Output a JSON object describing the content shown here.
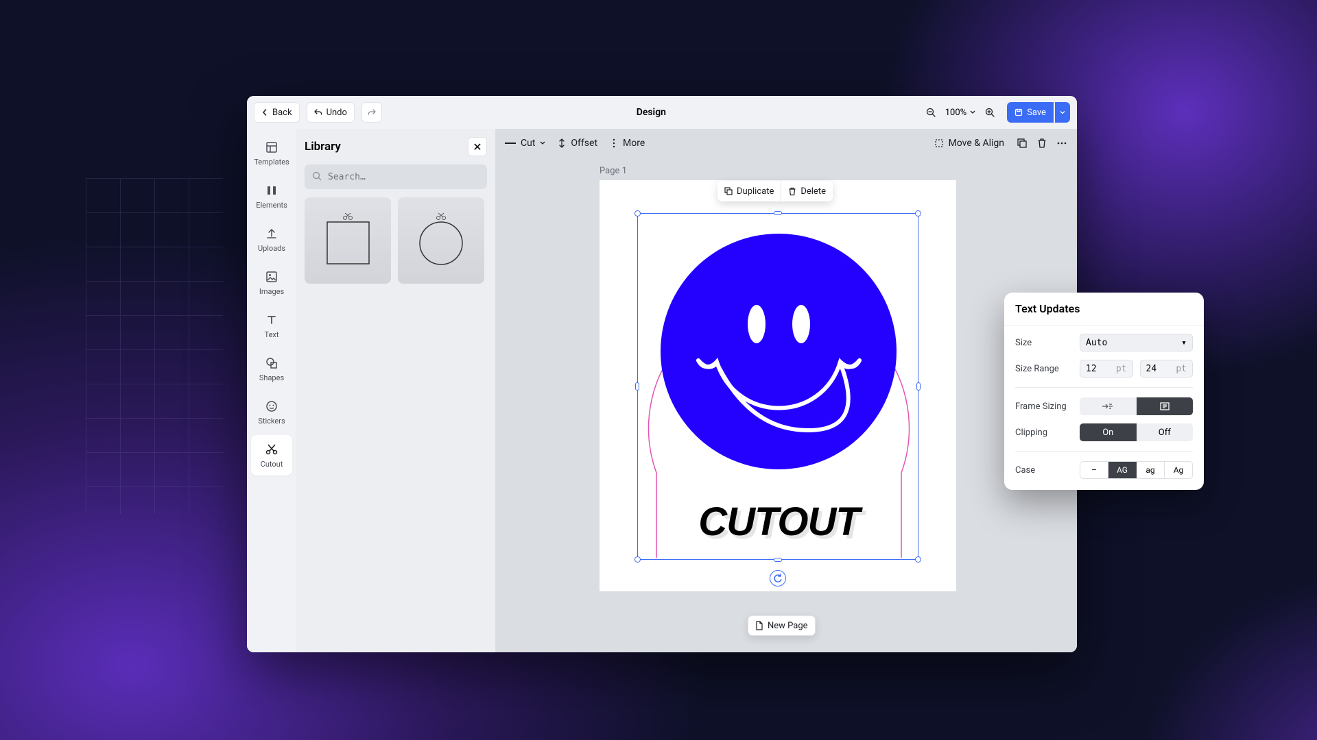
{
  "topbar": {
    "back": "Back",
    "undo": "Undo",
    "title": "Design",
    "zoom": "100%",
    "save": "Save"
  },
  "rail": {
    "items": [
      {
        "label": "Templates"
      },
      {
        "label": "Elements"
      },
      {
        "label": "Uploads"
      },
      {
        "label": "Images"
      },
      {
        "label": "Text"
      },
      {
        "label": "Shapes"
      },
      {
        "label": "Stickers"
      },
      {
        "label": "Cutout"
      }
    ]
  },
  "library": {
    "title": "Library",
    "search_placeholder": "Search…"
  },
  "canvas_toolbar": {
    "cut": "Cut",
    "offset": "Offset",
    "more": "More",
    "move_align": "Move & Align"
  },
  "canvas": {
    "page_label": "Page 1",
    "duplicate": "Duplicate",
    "delete": "Delete",
    "new_page": "New Page",
    "artwork_text": "CUTOUT"
  },
  "popover": {
    "title": "Text Updates",
    "size_label": "Size",
    "size_value": "Auto",
    "range_label": "Size Range",
    "range_min": "12",
    "range_max": "24",
    "range_unit": "pt",
    "frame_label": "Frame Sizing",
    "clipping_label": "Clipping",
    "clipping_on": "On",
    "clipping_off": "Off",
    "case_label": "Case",
    "case_opts": [
      "–",
      "AG",
      "ag",
      "Ag"
    ]
  }
}
